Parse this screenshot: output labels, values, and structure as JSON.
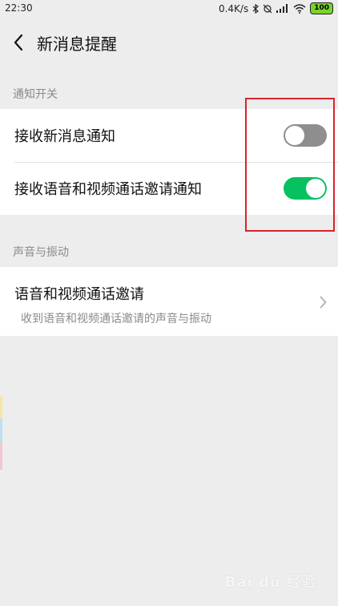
{
  "status_bar": {
    "time": "22:30",
    "net_speed": "0.4K/s",
    "battery": "100",
    "icons": [
      "bluetooth-icon",
      "alarm-off-icon",
      "signal-icon",
      "wifi-icon",
      "battery-icon"
    ]
  },
  "header": {
    "title": "新消息提醒",
    "back_icon": "chevron-left-icon"
  },
  "sections": {
    "notify": {
      "label": "通知开关",
      "items": [
        {
          "label": "接收新消息通知",
          "toggle": "off"
        },
        {
          "label": "接收语音和视频通话邀请通知",
          "toggle": "on"
        }
      ]
    },
    "sound": {
      "label": "声音与振动",
      "item": {
        "title": "语音和视频通话邀请",
        "subtitle": "收到语音和视频通话邀请的声音与振动"
      }
    }
  },
  "watermark": "Bai du 经验",
  "colors": {
    "background": "#ededed",
    "toggle_on": "#07c160",
    "toggle_off": "#8e8e8e",
    "highlight": "#d8242b",
    "battery": "#7ad32b"
  }
}
